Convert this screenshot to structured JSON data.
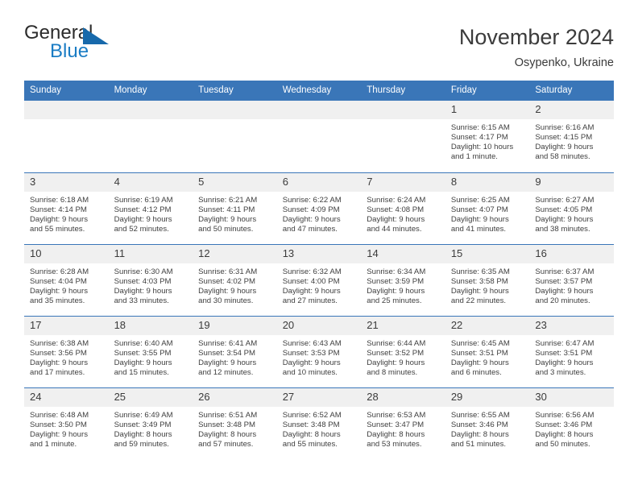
{
  "brand": {
    "name_part1": "General",
    "name_part2": "Blue",
    "triangle_icon": "triangle-icon",
    "accent_color": "#1a7cc4"
  },
  "header": {
    "month_title": "November 2024",
    "location": "Osypenko, Ukraine"
  },
  "theme": {
    "header_blue": "#3a76b8",
    "daynum_gray": "#f0f0f0",
    "text": "#3f3f3f"
  },
  "calendar": {
    "weekday_headers": [
      "Sunday",
      "Monday",
      "Tuesday",
      "Wednesday",
      "Thursday",
      "Friday",
      "Saturday"
    ],
    "weeks": [
      [
        {
          "day": "",
          "empty": true,
          "sunrise": "",
          "sunset": "",
          "daylight_line1": "",
          "daylight_line2": ""
        },
        {
          "day": "",
          "empty": true,
          "sunrise": "",
          "sunset": "",
          "daylight_line1": "",
          "daylight_line2": ""
        },
        {
          "day": "",
          "empty": true,
          "sunrise": "",
          "sunset": "",
          "daylight_line1": "",
          "daylight_line2": ""
        },
        {
          "day": "",
          "empty": true,
          "sunrise": "",
          "sunset": "",
          "daylight_line1": "",
          "daylight_line2": ""
        },
        {
          "day": "",
          "empty": true,
          "sunrise": "",
          "sunset": "",
          "daylight_line1": "",
          "daylight_line2": ""
        },
        {
          "day": "1",
          "empty": false,
          "sunrise": "Sunrise: 6:15 AM",
          "sunset": "Sunset: 4:17 PM",
          "daylight_line1": "Daylight: 10 hours",
          "daylight_line2": "and 1 minute."
        },
        {
          "day": "2",
          "empty": false,
          "sunrise": "Sunrise: 6:16 AM",
          "sunset": "Sunset: 4:15 PM",
          "daylight_line1": "Daylight: 9 hours",
          "daylight_line2": "and 58 minutes."
        }
      ],
      [
        {
          "day": "3",
          "empty": false,
          "sunrise": "Sunrise: 6:18 AM",
          "sunset": "Sunset: 4:14 PM",
          "daylight_line1": "Daylight: 9 hours",
          "daylight_line2": "and 55 minutes."
        },
        {
          "day": "4",
          "empty": false,
          "sunrise": "Sunrise: 6:19 AM",
          "sunset": "Sunset: 4:12 PM",
          "daylight_line1": "Daylight: 9 hours",
          "daylight_line2": "and 52 minutes."
        },
        {
          "day": "5",
          "empty": false,
          "sunrise": "Sunrise: 6:21 AM",
          "sunset": "Sunset: 4:11 PM",
          "daylight_line1": "Daylight: 9 hours",
          "daylight_line2": "and 50 minutes."
        },
        {
          "day": "6",
          "empty": false,
          "sunrise": "Sunrise: 6:22 AM",
          "sunset": "Sunset: 4:09 PM",
          "daylight_line1": "Daylight: 9 hours",
          "daylight_line2": "and 47 minutes."
        },
        {
          "day": "7",
          "empty": false,
          "sunrise": "Sunrise: 6:24 AM",
          "sunset": "Sunset: 4:08 PM",
          "daylight_line1": "Daylight: 9 hours",
          "daylight_line2": "and 44 minutes."
        },
        {
          "day": "8",
          "empty": false,
          "sunrise": "Sunrise: 6:25 AM",
          "sunset": "Sunset: 4:07 PM",
          "daylight_line1": "Daylight: 9 hours",
          "daylight_line2": "and 41 minutes."
        },
        {
          "day": "9",
          "empty": false,
          "sunrise": "Sunrise: 6:27 AM",
          "sunset": "Sunset: 4:05 PM",
          "daylight_line1": "Daylight: 9 hours",
          "daylight_line2": "and 38 minutes."
        }
      ],
      [
        {
          "day": "10",
          "empty": false,
          "sunrise": "Sunrise: 6:28 AM",
          "sunset": "Sunset: 4:04 PM",
          "daylight_line1": "Daylight: 9 hours",
          "daylight_line2": "and 35 minutes."
        },
        {
          "day": "11",
          "empty": false,
          "sunrise": "Sunrise: 6:30 AM",
          "sunset": "Sunset: 4:03 PM",
          "daylight_line1": "Daylight: 9 hours",
          "daylight_line2": "and 33 minutes."
        },
        {
          "day": "12",
          "empty": false,
          "sunrise": "Sunrise: 6:31 AM",
          "sunset": "Sunset: 4:02 PM",
          "daylight_line1": "Daylight: 9 hours",
          "daylight_line2": "and 30 minutes."
        },
        {
          "day": "13",
          "empty": false,
          "sunrise": "Sunrise: 6:32 AM",
          "sunset": "Sunset: 4:00 PM",
          "daylight_line1": "Daylight: 9 hours",
          "daylight_line2": "and 27 minutes."
        },
        {
          "day": "14",
          "empty": false,
          "sunrise": "Sunrise: 6:34 AM",
          "sunset": "Sunset: 3:59 PM",
          "daylight_line1": "Daylight: 9 hours",
          "daylight_line2": "and 25 minutes."
        },
        {
          "day": "15",
          "empty": false,
          "sunrise": "Sunrise: 6:35 AM",
          "sunset": "Sunset: 3:58 PM",
          "daylight_line1": "Daylight: 9 hours",
          "daylight_line2": "and 22 minutes."
        },
        {
          "day": "16",
          "empty": false,
          "sunrise": "Sunrise: 6:37 AM",
          "sunset": "Sunset: 3:57 PM",
          "daylight_line1": "Daylight: 9 hours",
          "daylight_line2": "and 20 minutes."
        }
      ],
      [
        {
          "day": "17",
          "empty": false,
          "sunrise": "Sunrise: 6:38 AM",
          "sunset": "Sunset: 3:56 PM",
          "daylight_line1": "Daylight: 9 hours",
          "daylight_line2": "and 17 minutes."
        },
        {
          "day": "18",
          "empty": false,
          "sunrise": "Sunrise: 6:40 AM",
          "sunset": "Sunset: 3:55 PM",
          "daylight_line1": "Daylight: 9 hours",
          "daylight_line2": "and 15 minutes."
        },
        {
          "day": "19",
          "empty": false,
          "sunrise": "Sunrise: 6:41 AM",
          "sunset": "Sunset: 3:54 PM",
          "daylight_line1": "Daylight: 9 hours",
          "daylight_line2": "and 12 minutes."
        },
        {
          "day": "20",
          "empty": false,
          "sunrise": "Sunrise: 6:43 AM",
          "sunset": "Sunset: 3:53 PM",
          "daylight_line1": "Daylight: 9 hours",
          "daylight_line2": "and 10 minutes."
        },
        {
          "day": "21",
          "empty": false,
          "sunrise": "Sunrise: 6:44 AM",
          "sunset": "Sunset: 3:52 PM",
          "daylight_line1": "Daylight: 9 hours",
          "daylight_line2": "and 8 minutes."
        },
        {
          "day": "22",
          "empty": false,
          "sunrise": "Sunrise: 6:45 AM",
          "sunset": "Sunset: 3:51 PM",
          "daylight_line1": "Daylight: 9 hours",
          "daylight_line2": "and 6 minutes."
        },
        {
          "day": "23",
          "empty": false,
          "sunrise": "Sunrise: 6:47 AM",
          "sunset": "Sunset: 3:51 PM",
          "daylight_line1": "Daylight: 9 hours",
          "daylight_line2": "and 3 minutes."
        }
      ],
      [
        {
          "day": "24",
          "empty": false,
          "sunrise": "Sunrise: 6:48 AM",
          "sunset": "Sunset: 3:50 PM",
          "daylight_line1": "Daylight: 9 hours",
          "daylight_line2": "and 1 minute."
        },
        {
          "day": "25",
          "empty": false,
          "sunrise": "Sunrise: 6:49 AM",
          "sunset": "Sunset: 3:49 PM",
          "daylight_line1": "Daylight: 8 hours",
          "daylight_line2": "and 59 minutes."
        },
        {
          "day": "26",
          "empty": false,
          "sunrise": "Sunrise: 6:51 AM",
          "sunset": "Sunset: 3:48 PM",
          "daylight_line1": "Daylight: 8 hours",
          "daylight_line2": "and 57 minutes."
        },
        {
          "day": "27",
          "empty": false,
          "sunrise": "Sunrise: 6:52 AM",
          "sunset": "Sunset: 3:48 PM",
          "daylight_line1": "Daylight: 8 hours",
          "daylight_line2": "and 55 minutes."
        },
        {
          "day": "28",
          "empty": false,
          "sunrise": "Sunrise: 6:53 AM",
          "sunset": "Sunset: 3:47 PM",
          "daylight_line1": "Daylight: 8 hours",
          "daylight_line2": "and 53 minutes."
        },
        {
          "day": "29",
          "empty": false,
          "sunrise": "Sunrise: 6:55 AM",
          "sunset": "Sunset: 3:46 PM",
          "daylight_line1": "Daylight: 8 hours",
          "daylight_line2": "and 51 minutes."
        },
        {
          "day": "30",
          "empty": false,
          "sunrise": "Sunrise: 6:56 AM",
          "sunset": "Sunset: 3:46 PM",
          "daylight_line1": "Daylight: 8 hours",
          "daylight_line2": "and 50 minutes."
        }
      ]
    ]
  }
}
